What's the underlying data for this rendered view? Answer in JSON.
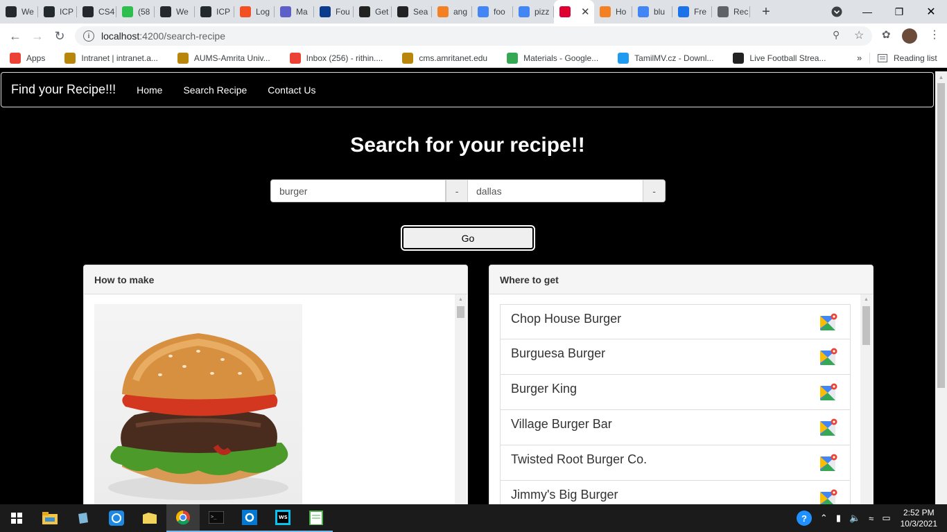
{
  "browser": {
    "tabs": [
      {
        "label": "We",
        "icon": "github-icon",
        "color": "#24292e"
      },
      {
        "label": "ICP",
        "icon": "github-icon",
        "color": "#24292e"
      },
      {
        "label": "CS4",
        "icon": "github-icon",
        "color": "#24292e"
      },
      {
        "label": "(58",
        "icon": "sb-icon",
        "color": "#2dbf4e"
      },
      {
        "label": "We",
        "icon": "github-icon",
        "color": "#24292e"
      },
      {
        "label": "ICP",
        "icon": "github-icon",
        "color": "#24292e"
      },
      {
        "label": "Log",
        "icon": "microsoft-icon",
        "color": "#f25022"
      },
      {
        "label": "Ma",
        "icon": "teams-icon",
        "color": "#5b5fc7"
      },
      {
        "label": "Fou",
        "icon": "f-icon",
        "color": "#0b3b8c"
      },
      {
        "label": "Get",
        "icon": "stackoverflow-icon",
        "color": "#222"
      },
      {
        "label": "Sea",
        "icon": "stackoverflow-icon",
        "color": "#222"
      },
      {
        "label": "ang",
        "icon": "stack-icon",
        "color": "#f48024"
      },
      {
        "label": "foo",
        "icon": "google-icon",
        "color": "#4285f4"
      },
      {
        "label": "pizz",
        "icon": "google-icon",
        "color": "#4285f4"
      },
      {
        "label": "",
        "icon": "angular-icon",
        "color": "#dd0031",
        "active": true
      },
      {
        "label": "Ho",
        "icon": "stack-icon",
        "color": "#f48024"
      },
      {
        "label": "blu",
        "icon": "google-icon",
        "color": "#4285f4"
      },
      {
        "label": "Fre",
        "icon": "ph-icon",
        "color": "#1a73e8"
      },
      {
        "label": "Rec",
        "icon": "globe-icon",
        "color": "#5f6368"
      }
    ],
    "url_host": "localhost",
    "url_path": ":4200/search-recipe",
    "bookmarks": [
      {
        "label": "Apps",
        "icon": "apps-grid-icon",
        "color": "#ea4335"
      },
      {
        "label": "Intranet | intranet.a...",
        "icon": "amrita-icon",
        "color": "#b8860b"
      },
      {
        "label": "AUMS-Amrita Univ...",
        "icon": "amrita-icon",
        "color": "#b8860b"
      },
      {
        "label": "Inbox (256) - rithin....",
        "icon": "gmail-icon",
        "color": "#ea4335"
      },
      {
        "label": "cms.amritanet.edu",
        "icon": "amrita-icon",
        "color": "#b8860b"
      },
      {
        "label": "Materials - Google...",
        "icon": "drive-icon",
        "color": "#34a853"
      },
      {
        "label": "TamilMV.cz - Downl...",
        "icon": "play-icon",
        "color": "#1e9bf0"
      },
      {
        "label": "Live Football Strea...",
        "icon": "football-icon",
        "color": "#222"
      }
    ],
    "reading_list": "Reading list"
  },
  "app": {
    "brand": "Find your Recipe!!!",
    "nav": [
      "Home",
      "Search Recipe",
      "Contact Us"
    ],
    "title": "Search for your recipe!!",
    "search": {
      "recipe_value": "burger",
      "location_value": "dallas",
      "addon_1": "-",
      "addon_2": "-"
    },
    "go_label": "Go",
    "how_to_make": {
      "heading": "How to make"
    },
    "where_to_get": {
      "heading": "Where to get",
      "places": [
        "Chop House Burger",
        "Burguesa Burger",
        "Burger King",
        "Village Burger Bar",
        "Twisted Root Burger Co.",
        "Jimmy's Big Burger"
      ]
    }
  },
  "taskbar": {
    "apps": [
      "windows-start-icon",
      "file-explorer-icon",
      "files-icon",
      "sync-icon",
      "folder-icon",
      "chrome-icon",
      "terminal-icon",
      "settings-icon",
      "webstorm-icon",
      "notepad-icon"
    ],
    "time": "2:52 PM",
    "date": "10/3/2021"
  }
}
